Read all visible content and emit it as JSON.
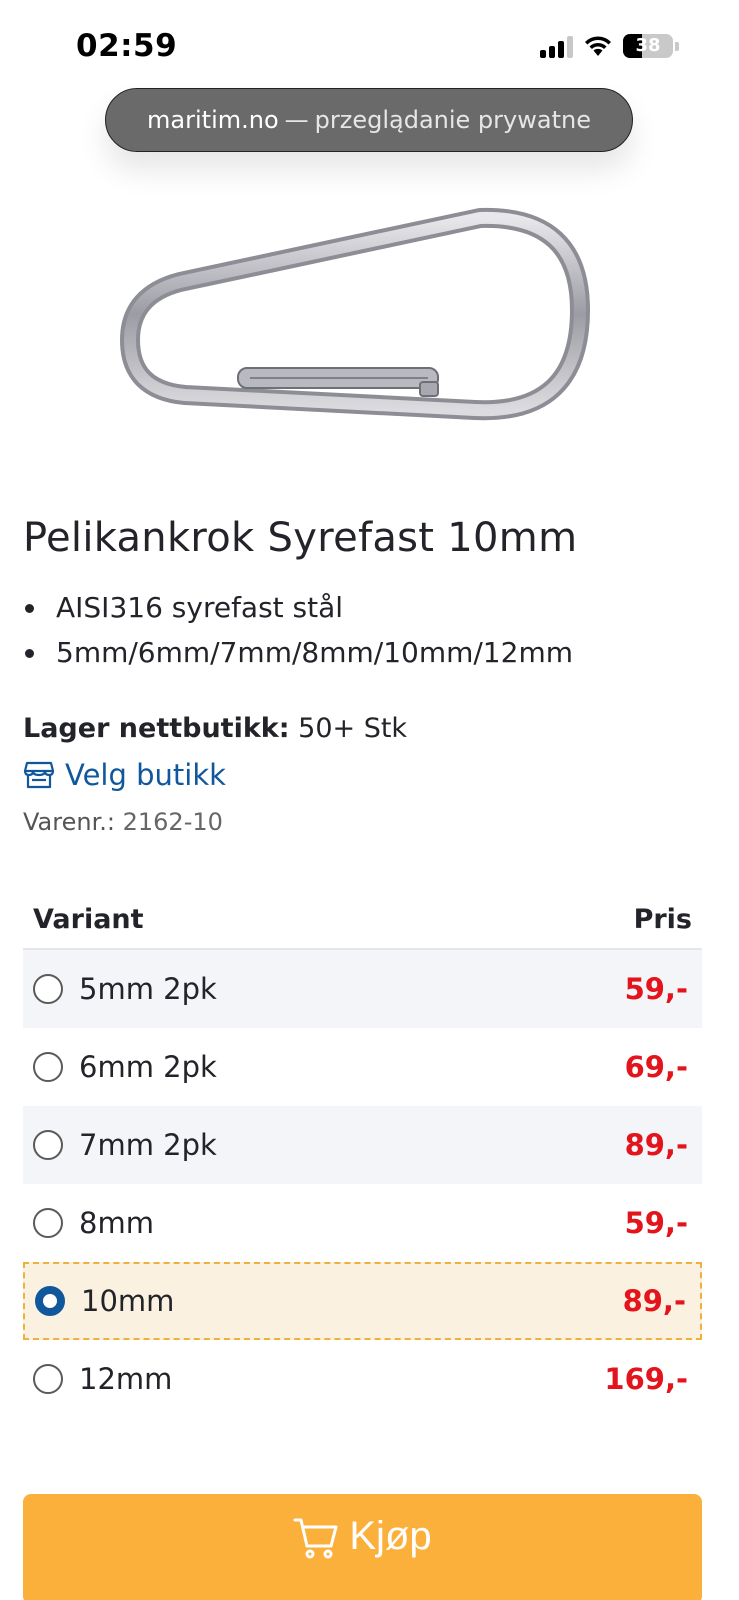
{
  "status_bar": {
    "time": "02:59",
    "battery": "38"
  },
  "browser": {
    "domain": "maritim.no",
    "separator": "—",
    "mode": "przeglądanie prywatne"
  },
  "product": {
    "title": "Pelikankrok Syrefast 10mm",
    "features": [
      "AISI316 syrefast stål",
      "5mm/6mm/7mm/8mm/10mm/12mm"
    ],
    "stock_label": "Lager nettbutikk:",
    "stock_value": "50+ Stk",
    "store_link": "Velg butikk",
    "sku_label": "Varenr.:",
    "sku_value": "2162-10"
  },
  "variants": {
    "header_variant": "Variant",
    "header_price": "Pris",
    "rows": [
      {
        "name": "5mm 2pk",
        "price": "59,-"
      },
      {
        "name": "6mm 2pk",
        "price": "69,-"
      },
      {
        "name": "7mm 2pk",
        "price": "89,-"
      },
      {
        "name": "8mm",
        "price": "59,-"
      },
      {
        "name": "10mm",
        "price": "89,-",
        "selected": true
      },
      {
        "name": "12mm",
        "price": "169,-"
      }
    ]
  },
  "buy_button": {
    "label": "Kjøp"
  },
  "colors": {
    "accent": "#fbb03b",
    "link": "#10589b",
    "price": "#e3141b",
    "selected_row": "#fbf1e1"
  }
}
